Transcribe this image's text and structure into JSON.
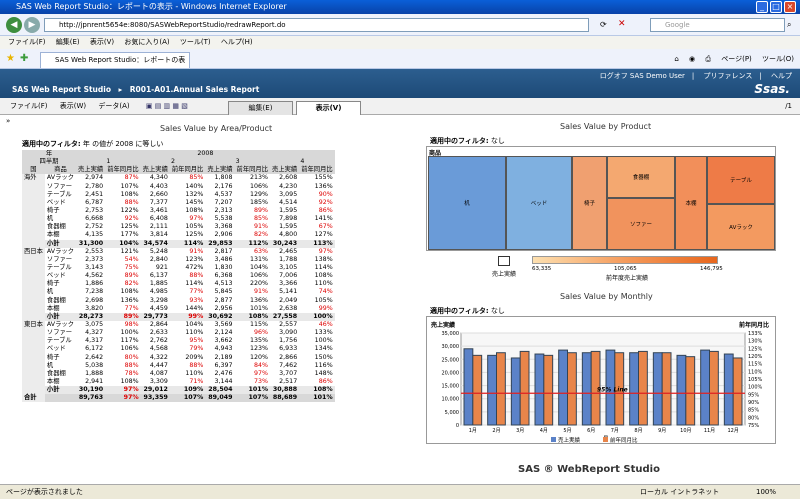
{
  "window": {
    "title": "SAS Web Report Studio：レポートの表示 - Windows Internet Explorer",
    "url": "http://jpnrent5654e:8080/SASWebReportStudio/redrawReport.do",
    "search_placeholder": "Google"
  },
  "ie_menu": [
    "ファイル(F)",
    "編集(E)",
    "表示(V)",
    "お気に入り(A)",
    "ツール(T)",
    "ヘルプ(H)"
  ],
  "ie_tab": "SAS Web Report Studio：レポートの表示",
  "ie_tools": {
    "page": "ページ(P)",
    "tools": "ツール(O)"
  },
  "sas": {
    "breadcrumb": "SAS Web Report Studio　▸　R001-A01.Annual Sales Report",
    "logoff": "ログオフ SAS Demo User",
    "prefs": "プリファレンス",
    "help": "ヘルプ",
    "logo": "Ssas."
  },
  "app_menu": [
    "ファイル(F)",
    "表示(W)",
    "データ(A)"
  ],
  "tabs": {
    "edit": "編集(E)",
    "view": "表示(V)"
  },
  "page_num": "/1",
  "left": {
    "title": "Sales Value by Area/Product",
    "filter_label": "適用中のフィルタ:",
    "filter_value": "年 の値が 2008 に等しい"
  },
  "table": {
    "hdr1": [
      "年",
      "2008"
    ],
    "hdr2": [
      "四半期",
      "1",
      "2",
      "3",
      "4"
    ],
    "hdr3": [
      "国",
      "商品",
      "売上実績",
      "前年同月比",
      "売上実績",
      "前年同月比",
      "売上実績",
      "前年同月比",
      "売上実績",
      "前年同月比"
    ],
    "rows": [
      [
        "海外",
        "AVラック",
        "2,974",
        "87%",
        "4,340",
        "85%",
        "1,808",
        "213%",
        "2,608",
        "155%"
      ],
      [
        "",
        "ソファー",
        "2,780",
        "107%",
        "4,403",
        "140%",
        "2,176",
        "106%",
        "4,230",
        "136%"
      ],
      [
        "",
        "テーブル",
        "2,451",
        "108%",
        "2,660",
        "132%",
        "4,537",
        "129%",
        "3,095",
        "90%"
      ],
      [
        "",
        "ベッド",
        "6,787",
        "88%",
        "7,377",
        "145%",
        "7,207",
        "185%",
        "4,514",
        "92%"
      ],
      [
        "",
        "椅子",
        "2,753",
        "122%",
        "3,461",
        "108%",
        "2,313",
        "89%",
        "1,595",
        "86%"
      ],
      [
        "",
        "机",
        "6,668",
        "92%",
        "6,408",
        "97%",
        "5,538",
        "85%",
        "7,898",
        "141%"
      ],
      [
        "",
        "食器棚",
        "2,752",
        "125%",
        "2,111",
        "105%",
        "3,368",
        "91%",
        "1,595",
        "67%"
      ],
      [
        "",
        "本棚",
        "4,135",
        "177%",
        "3,814",
        "125%",
        "2,906",
        "82%",
        "4,800",
        "127%"
      ],
      [
        "",
        "小計",
        "31,300",
        "104%",
        "34,574",
        "114%",
        "29,853",
        "112%",
        "30,243",
        "113%"
      ],
      [
        "西日本",
        "AVラック",
        "2,553",
        "121%",
        "5,248",
        "91%",
        "2,817",
        "63%",
        "2,465",
        "97%"
      ],
      [
        "",
        "ソファー",
        "2,373",
        "54%",
        "2,840",
        "123%",
        "3,486",
        "131%",
        "1,788",
        "138%"
      ],
      [
        "",
        "テーブル",
        "3,143",
        "75%",
        "921",
        "472%",
        "1,830",
        "104%",
        "3,105",
        "114%"
      ],
      [
        "",
        "ベッド",
        "4,562",
        "89%",
        "6,137",
        "88%",
        "6,368",
        "106%",
        "7,006",
        "108%"
      ],
      [
        "",
        "椅子",
        "1,886",
        "82%",
        "1,885",
        "114%",
        "4,513",
        "220%",
        "3,366",
        "110%"
      ],
      [
        "",
        "机",
        "7,238",
        "108%",
        "4,985",
        "77%",
        "5,845",
        "91%",
        "5,141",
        "74%"
      ],
      [
        "",
        "食器棚",
        "2,698",
        "136%",
        "3,298",
        "93%",
        "2,877",
        "136%",
        "2,049",
        "105%"
      ],
      [
        "",
        "本棚",
        "3,820",
        "77%",
        "4,459",
        "144%",
        "2,956",
        "101%",
        "2,638",
        "99%"
      ],
      [
        "",
        "小計",
        "28,273",
        "89%",
        "29,773",
        "99%",
        "30,692",
        "108%",
        "27,558",
        "100%"
      ],
      [
        "東日本",
        "AVラック",
        "3,075",
        "98%",
        "2,864",
        "104%",
        "3,569",
        "115%",
        "2,557",
        "46%"
      ],
      [
        "",
        "ソファー",
        "4,327",
        "100%",
        "2,633",
        "110%",
        "2,124",
        "96%",
        "3,090",
        "133%"
      ],
      [
        "",
        "テーブル",
        "4,317",
        "117%",
        "2,762",
        "95%",
        "3,662",
        "135%",
        "1,756",
        "100%"
      ],
      [
        "",
        "ベッド",
        "6,172",
        "106%",
        "4,568",
        "79%",
        "4,943",
        "123%",
        "6,933",
        "134%"
      ],
      [
        "",
        "椅子",
        "2,642",
        "80%",
        "4,322",
        "209%",
        "2,189",
        "120%",
        "2,866",
        "150%"
      ],
      [
        "",
        "机",
        "5,038",
        "88%",
        "4,447",
        "88%",
        "6,397",
        "84%",
        "7,462",
        "116%"
      ],
      [
        "",
        "食器棚",
        "1,888",
        "78%",
        "4,087",
        "110%",
        "2,476",
        "97%",
        "3,707",
        "148%"
      ],
      [
        "",
        "本棚",
        "2,941",
        "108%",
        "3,309",
        "71%",
        "3,144",
        "73%",
        "2,517",
        "86%"
      ],
      [
        "",
        "小計",
        "30,190",
        "97%",
        "29,012",
        "109%",
        "28,504",
        "101%",
        "30,888",
        "108%"
      ],
      [
        "合計",
        "",
        "89,763",
        "97%",
        "93,359",
        "107%",
        "89,049",
        "107%",
        "88,689",
        "101%"
      ]
    ]
  },
  "product": {
    "title": "Sales Value by Product",
    "filter_label": "適用中のフィルタ:",
    "filter_value": "なし",
    "header": "商品",
    "cells": [
      "机",
      "ベッド",
      "椅子",
      "食器棚",
      "ソファー",
      "本棚",
      "テーブル",
      "AVラック"
    ],
    "legend": {
      "min": "63,335",
      "mid": "105,065",
      "max": "146,795",
      "measure_size": "売上実績",
      "measure_color": "前年度売上実績"
    }
  },
  "monthly": {
    "title": "Sales Value by Monthly",
    "filter_label": "適用中のフィルタ:",
    "filter_value": "なし",
    "y_left_label": "売上実績",
    "y_right_label": "前年同月比",
    "line_label": "95% Line",
    "xlabel": "月",
    "legend": [
      "売上実績",
      "前年同月比"
    ],
    "y_ticks_left": [
      "0",
      "5,000",
      "10,000",
      "15,000",
      "20,000",
      "25,000",
      "30,000",
      "35,000"
    ],
    "y_ticks_right": [
      "75%",
      "80%",
      "85%",
      "90%",
      "95%",
      "100%",
      "105%",
      "110%",
      "115%",
      "120%",
      "125%",
      "130%",
      "133%"
    ],
    "colors": {
      "bar1": "#5b82c8",
      "bar2": "#e8854a",
      "line": "#e02020"
    }
  },
  "footer": "SAS ® WebReport Studio",
  "status": {
    "left": "ページが表示されました",
    "zone": "ローカル イントラネット",
    "zoom": "100%"
  },
  "chart_data": {
    "type": "bar",
    "title": "Sales Value by Monthly",
    "categories": [
      "1月",
      "2月",
      "3月",
      "4月",
      "5月",
      "6月",
      "7月",
      "8月",
      "9月",
      "10月",
      "11月",
      "12月"
    ],
    "series": [
      {
        "name": "売上実績",
        "values": [
          29000,
          26500,
          25500,
          27000,
          28500,
          27500,
          28500,
          27500,
          27500,
          26500,
          28500,
          27000
        ]
      },
      {
        "name": "前年同月比",
        "values": [
          26500,
          27500,
          28000,
          26500,
          27500,
          28000,
          27500,
          28000,
          27500,
          26000,
          28000,
          25500
        ]
      }
    ],
    "ylim": [
      0,
      35000
    ],
    "reference_line": {
      "label": "95% Line",
      "value": 95
    }
  }
}
